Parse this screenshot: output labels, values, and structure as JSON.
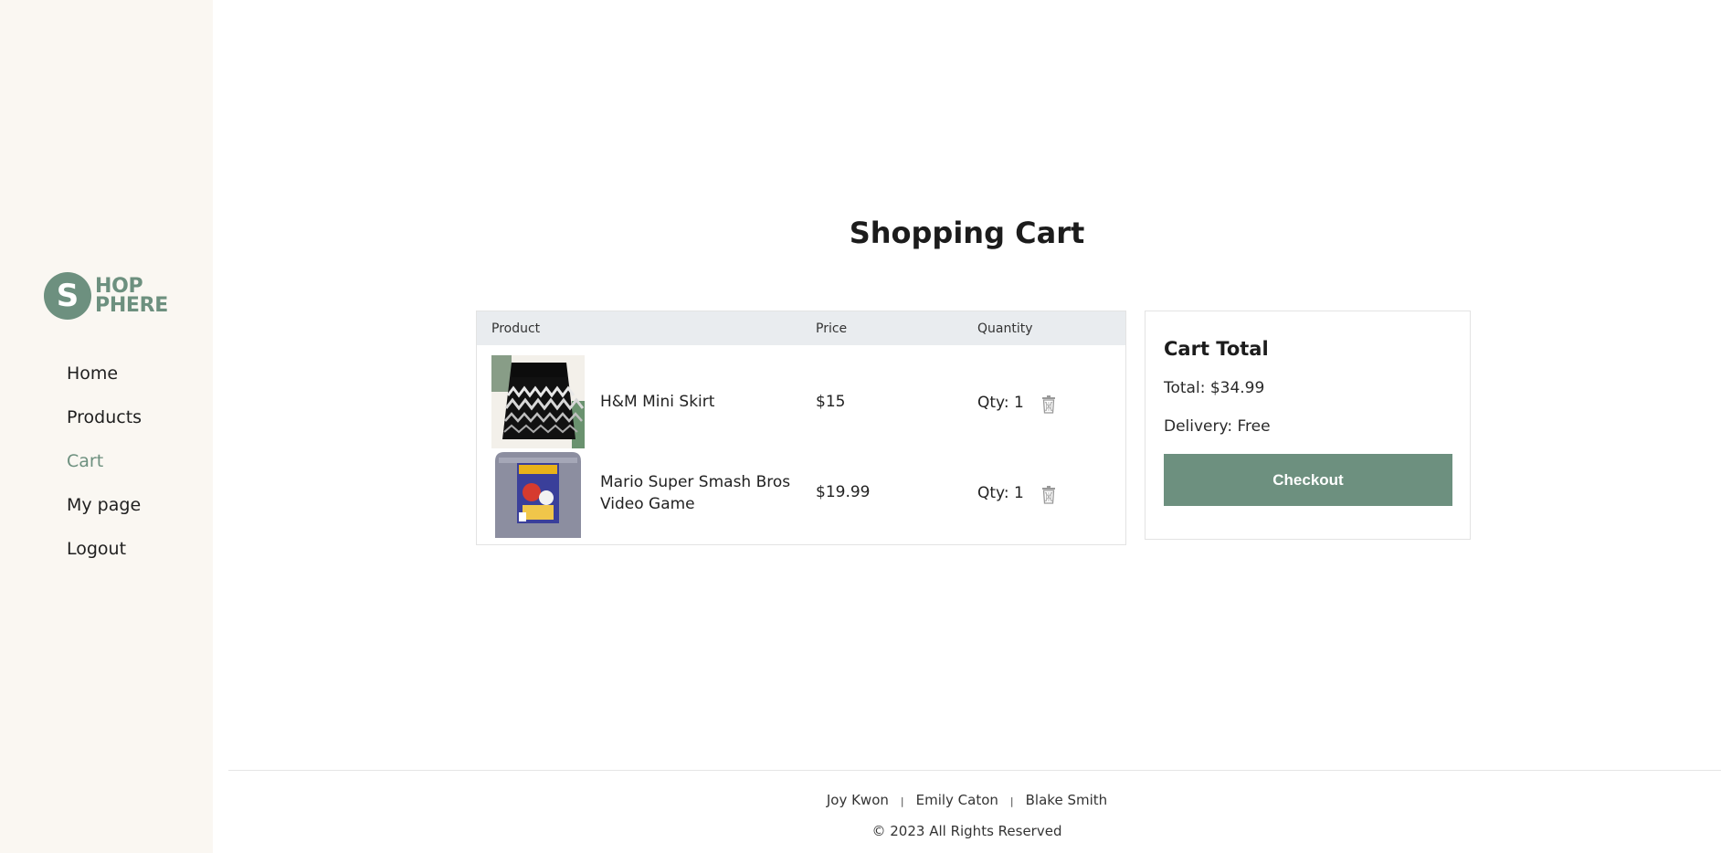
{
  "brand": {
    "logo_letter": "S",
    "logo_line1": "HOP",
    "logo_line2": "PHERE",
    "accent_color": "#6d907f"
  },
  "nav": {
    "items": [
      {
        "label": "Home"
      },
      {
        "label": "Products"
      },
      {
        "label": "Cart",
        "active": true
      },
      {
        "label": "My page"
      },
      {
        "label": "Logout"
      }
    ]
  },
  "page": {
    "title": "Shopping Cart"
  },
  "cart": {
    "headers": {
      "product": "Product",
      "price": "Price",
      "quantity": "Quantity"
    },
    "items": [
      {
        "name": "H&M Mini Skirt",
        "price": "$15",
        "qty": "Qty: 1",
        "thumb_icon": "skirt-image"
      },
      {
        "name": "Mario Super Smash Bros Video Game",
        "price": "$19.99",
        "qty": "Qty: 1",
        "thumb_icon": "game-cartridge-image"
      }
    ]
  },
  "summary": {
    "title": "Cart Total",
    "total": "Total: $34.99",
    "delivery": "Delivery: Free",
    "checkout_label": "Checkout"
  },
  "footer": {
    "names": [
      "Joy Kwon",
      "Emily Caton",
      "Blake Smith"
    ],
    "copyright": "© 2023 All Rights Reserved"
  }
}
